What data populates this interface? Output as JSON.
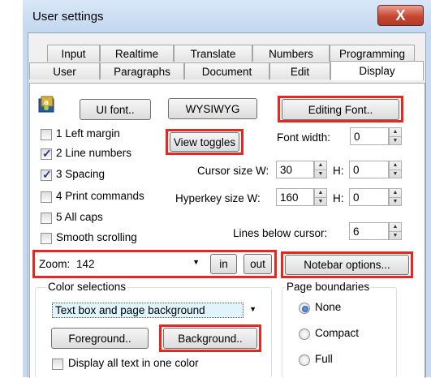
{
  "window": {
    "title": "User settings",
    "close_glyph": "X"
  },
  "tabs_back": [
    "Input",
    "Realtime",
    "Translate",
    "Numbers",
    "Programming"
  ],
  "tabs_front": [
    "User",
    "Paragraphs",
    "Document",
    "Edit",
    "Display"
  ],
  "active_tab": "Display",
  "buttons": {
    "ui_font": "UI font..",
    "wysiwyg": "WYSIWYG",
    "editing_font": "Editing Font..",
    "view_toggles": "View toggles",
    "zoom_in": "in",
    "zoom_out": "out",
    "notebar_options": "Notebar options...",
    "foreground": "Foreground..",
    "background": "Background.."
  },
  "checkboxes": [
    {
      "label": "1 Left margin",
      "checked": false
    },
    {
      "label": "2 Line numbers",
      "checked": true
    },
    {
      "label": "3 Spacing",
      "checked": true
    },
    {
      "label": "4 Print commands",
      "checked": false
    },
    {
      "label": "5 All caps",
      "checked": false
    },
    {
      "label": "Smooth scrolling",
      "checked": false
    }
  ],
  "fields": {
    "font_width": {
      "label": "Font width:",
      "value": "0"
    },
    "cursor_size": {
      "label": "Cursor size W:",
      "w": "30",
      "h_label": "H:",
      "h": "0"
    },
    "hyperkey_size": {
      "label": "Hyperkey size W:",
      "w": "160",
      "h_label": "H:",
      "h": "0"
    },
    "lines_below": {
      "label": "Lines below cursor:",
      "value": "6"
    }
  },
  "zoom": {
    "label": "Zoom:",
    "value": "142"
  },
  "color_selections": {
    "title": "Color selections",
    "selected": "Text box and page background",
    "display_all_label": "Display all text in one color"
  },
  "page_boundaries": {
    "title": "Page boundaries",
    "options": [
      {
        "label": "None",
        "checked": true
      },
      {
        "label": "Compact",
        "checked": false
      },
      {
        "label": "Full",
        "checked": false
      }
    ]
  },
  "colors": {
    "highlight_red": "#e8281e",
    "selection_cyan": "#dff4fb"
  }
}
